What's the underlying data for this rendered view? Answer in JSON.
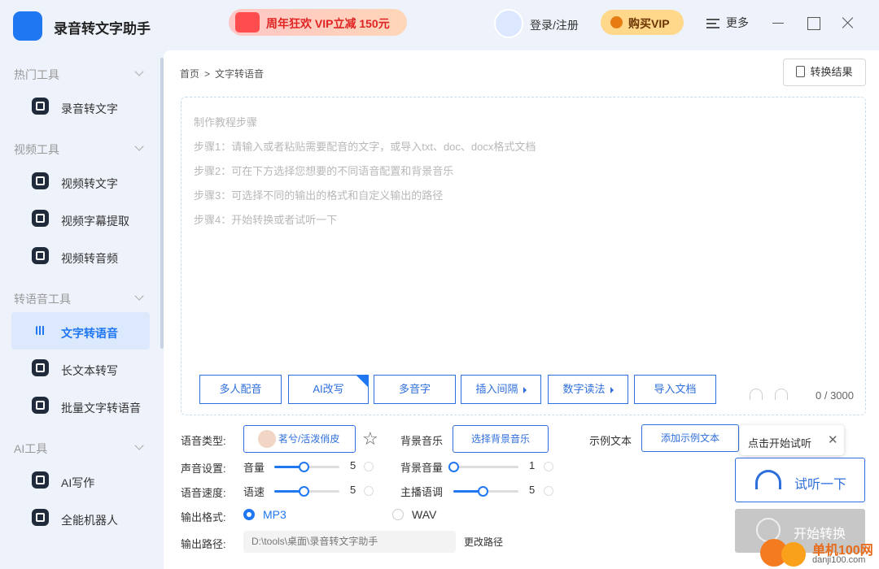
{
  "app": {
    "title": "录音转文字助手"
  },
  "header": {
    "promo": "周年狂欢 VIP立减 150元",
    "login": "登录/注册",
    "vip": "购买VIP",
    "more": "更多"
  },
  "sidebar": {
    "sections": [
      {
        "label": "热门工具",
        "items": [
          {
            "label": "录音转文字",
            "icon": "text-icon"
          }
        ]
      },
      {
        "label": "视频工具",
        "items": [
          {
            "label": "视频转文字",
            "icon": "video-text-icon"
          },
          {
            "label": "视频字幕提取",
            "icon": "subtitle-icon"
          },
          {
            "label": "视频转音频",
            "icon": "video-audio-icon"
          }
        ]
      },
      {
        "label": "转语音工具",
        "items": [
          {
            "label": "文字转语音",
            "icon": "voice-wave-icon",
            "active": true
          },
          {
            "label": "长文本转写",
            "icon": "long-text-icon"
          },
          {
            "label": "批量文字转语音",
            "icon": "batch-voice-icon"
          }
        ]
      },
      {
        "label": "AI工具",
        "items": [
          {
            "label": "AI写作",
            "icon": "ai-write-icon"
          },
          {
            "label": "全能机器人",
            "icon": "robot-icon"
          }
        ]
      }
    ]
  },
  "breadcrumb": {
    "home": "首页",
    "sep": ">",
    "current": "文字转语音"
  },
  "result_button": "转换结果",
  "editor": {
    "lines": [
      "制作教程步骤",
      "步骤1：请输入或者粘贴需要配音的文字，或导入txt、doc、docx格式文档",
      "步骤2：可在下方选择您想要的不同语音配置和背景音乐",
      "步骤3：可选择不同的输出的格式和自定义输出的路径",
      "步骤4：开始转换或者试听一下"
    ],
    "counter": "0 / 3000"
  },
  "toolbar": {
    "multi_voice": "多人配音",
    "ai_rewrite": "AI改写",
    "polyphone": "多音字",
    "insert_pause": "插入间隔",
    "number_read": "数字读法",
    "import_doc": "导入文档"
  },
  "settings": {
    "voice_type_label": "语音类型:",
    "voice_name": "茗兮/活泼俏皮",
    "bg_music_label": "背景音乐",
    "bg_music_button": "选择背景音乐",
    "sample_label": "示例文本",
    "sample_button": "添加示例文本",
    "sound_label": "声音设置:",
    "volume_label": "音量",
    "volume_value": "5",
    "bg_volume_label": "背景音量",
    "bg_volume_value": "1",
    "speed_label": "语音速度:",
    "speed_sub_label": "语速",
    "speed_value": "5",
    "pitch_label": "主播语调",
    "pitch_value": "5",
    "format_label": "输出格式:",
    "format_mp3": "MP3",
    "format_wav": "WAV",
    "path_label": "输出路径:",
    "path_value": "D:\\tools\\桌面\\录音转文字助手",
    "change_path": "更改路径"
  },
  "levels": {
    "volume": 0.45,
    "bg_volume": 0.0,
    "speed": 0.45,
    "pitch": 0.45
  },
  "tooltip": {
    "text": "点击开始试听",
    "close": "✕"
  },
  "actions": {
    "listen": "试听一下",
    "start": "开始转换"
  },
  "watermark": {
    "site": "单机100网",
    "url": "danji100.com"
  }
}
